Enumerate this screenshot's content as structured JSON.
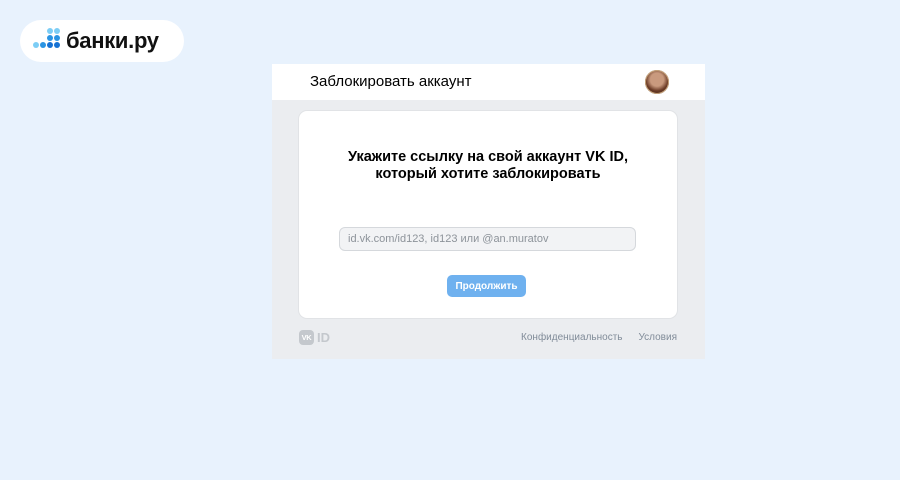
{
  "brand": {
    "logo_text": "банки.ру",
    "dot_colors": [
      "#7ccdf5",
      "#2a94e3",
      "#1672d4"
    ]
  },
  "modal": {
    "title": "Заблокировать аккаунт",
    "heading_line1": "Укажите ссылку на свой аккаунт VK ID,",
    "heading_line2": "который хотите заблокировать",
    "input_value": "",
    "input_placeholder": "id.vk.com/id123, id123 или @an.muratov",
    "continue_label": "Продолжить",
    "accent_color": "#6fb1ef"
  },
  "footer": {
    "vk_badge": "VK",
    "id_label": "ID",
    "privacy_link": "Конфиденциальность",
    "terms_link": "Условия"
  }
}
